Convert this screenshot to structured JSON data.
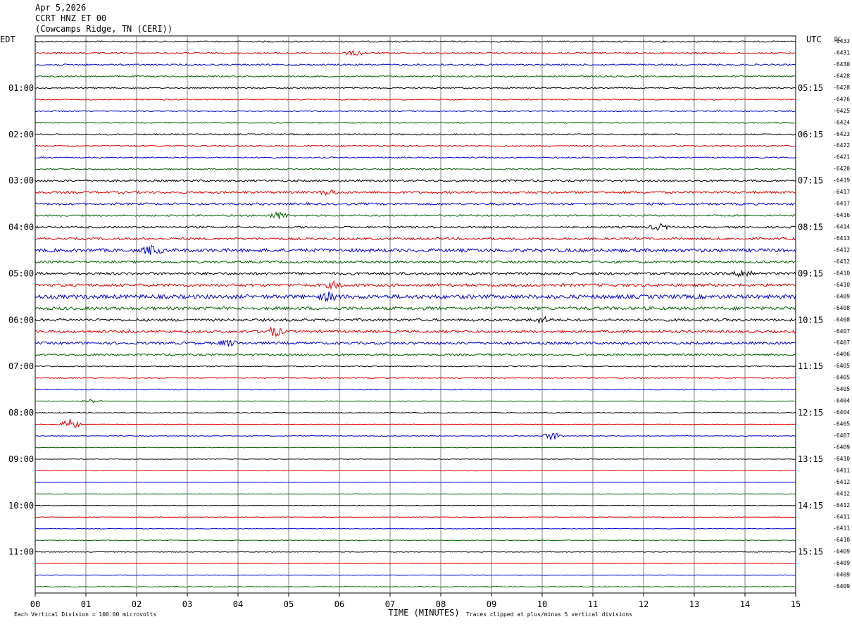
{
  "header": {
    "date": "Apr 5,2026",
    "station": "CCRT HNZ ET 00",
    "location": "(Cowcamps Ridge, TN (CERI))"
  },
  "chart_data": {
    "type": "line",
    "title": "",
    "left_timezone": "EDT",
    "right_timezone": "UTC",
    "dc_header": "DC",
    "xlabel": "TIME (MINUTES)",
    "xlim": [
      0,
      15
    ],
    "x_ticks": [
      "00",
      "01",
      "02",
      "03",
      "04",
      "05",
      "06",
      "07",
      "08",
      "09",
      "10",
      "11",
      "12",
      "13",
      "14",
      "15"
    ],
    "left_hour_labels": [
      "01:00",
      "02:00",
      "03:00",
      "04:00",
      "05:00",
      "06:00",
      "07:00",
      "08:00",
      "09:00",
      "10:00",
      "11:00"
    ],
    "right_hour_labels": [
      "05:15",
      "06:15",
      "07:15",
      "08:15",
      "09:15",
      "10:15",
      "11:15",
      "12:15",
      "13:15",
      "14:15",
      "15:15"
    ],
    "trace_colors": [
      "#000000",
      "#e00000",
      "#0000d0",
      "#006000"
    ],
    "dc_offsets": [
      "-6433",
      "-6431",
      "-6430",
      "-6428",
      "-6428",
      "-6426",
      "-6425",
      "-6424",
      "-6423",
      "-6422",
      "-6421",
      "-6420",
      "-6419",
      "-6417",
      "-6417",
      "-6416",
      "-6414",
      "-6413",
      "-6412",
      "-6412",
      "-6410",
      "-6410",
      "-6409",
      "-6408",
      "-6408",
      "-6407",
      "-6407",
      "-6406",
      "-6405",
      "-6405",
      "-6405",
      "-6404",
      "-6404",
      "-6405",
      "-6407",
      "-6409",
      "-6410",
      "-6411",
      "-6412",
      "-6412",
      "-6412",
      "-6411",
      "-6411",
      "-6410",
      "-6409",
      "-6409",
      "-6409",
      "-6409"
    ],
    "noise_levels": [
      1.0,
      1.2,
      1.1,
      1.0,
      0.8,
      0.8,
      0.8,
      0.8,
      1.0,
      1.0,
      0.9,
      0.9,
      1.4,
      1.6,
      1.6,
      1.2,
      1.4,
      1.6,
      2.4,
      1.6,
      1.8,
      2.0,
      2.8,
      2.2,
      1.8,
      1.8,
      1.8,
      1.4,
      0.8,
      0.8,
      0.8,
      0.4,
      0.6,
      0.4,
      0.5,
      0.4,
      0.4,
      0.3,
      0.4,
      0.3,
      0.4,
      0.4,
      0.4,
      0.5,
      0.5,
      0.4,
      0.4,
      0.6
    ],
    "bursts": [
      {
        "row": 1,
        "minute": 6.3,
        "amp": 3
      },
      {
        "row": 15,
        "minute": 4.8,
        "amp": 5
      },
      {
        "row": 13,
        "minute": 5.8,
        "amp": 4
      },
      {
        "row": 18,
        "minute": 2.3,
        "amp": 6
      },
      {
        "row": 16,
        "minute": 12.3,
        "amp": 4
      },
      {
        "row": 21,
        "minute": 5.9,
        "amp": 4
      },
      {
        "row": 22,
        "minute": 5.8,
        "amp": 5
      },
      {
        "row": 20,
        "minute": 14.0,
        "amp": 6
      },
      {
        "row": 25,
        "minute": 4.7,
        "amp": 7
      },
      {
        "row": 26,
        "minute": 3.8,
        "amp": 4
      },
      {
        "row": 24,
        "minute": 10.0,
        "amp": 4
      },
      {
        "row": 33,
        "minute": 0.7,
        "amp": 8
      },
      {
        "row": 34,
        "minute": 10.2,
        "amp": 6
      },
      {
        "row": 31,
        "minute": 1.1,
        "amp": 3
      }
    ],
    "footer_left": "Each Vertical Division =  100.00 microvolts",
    "footer_right": "Traces clipped at plus/minus 5 vertical divisions"
  }
}
